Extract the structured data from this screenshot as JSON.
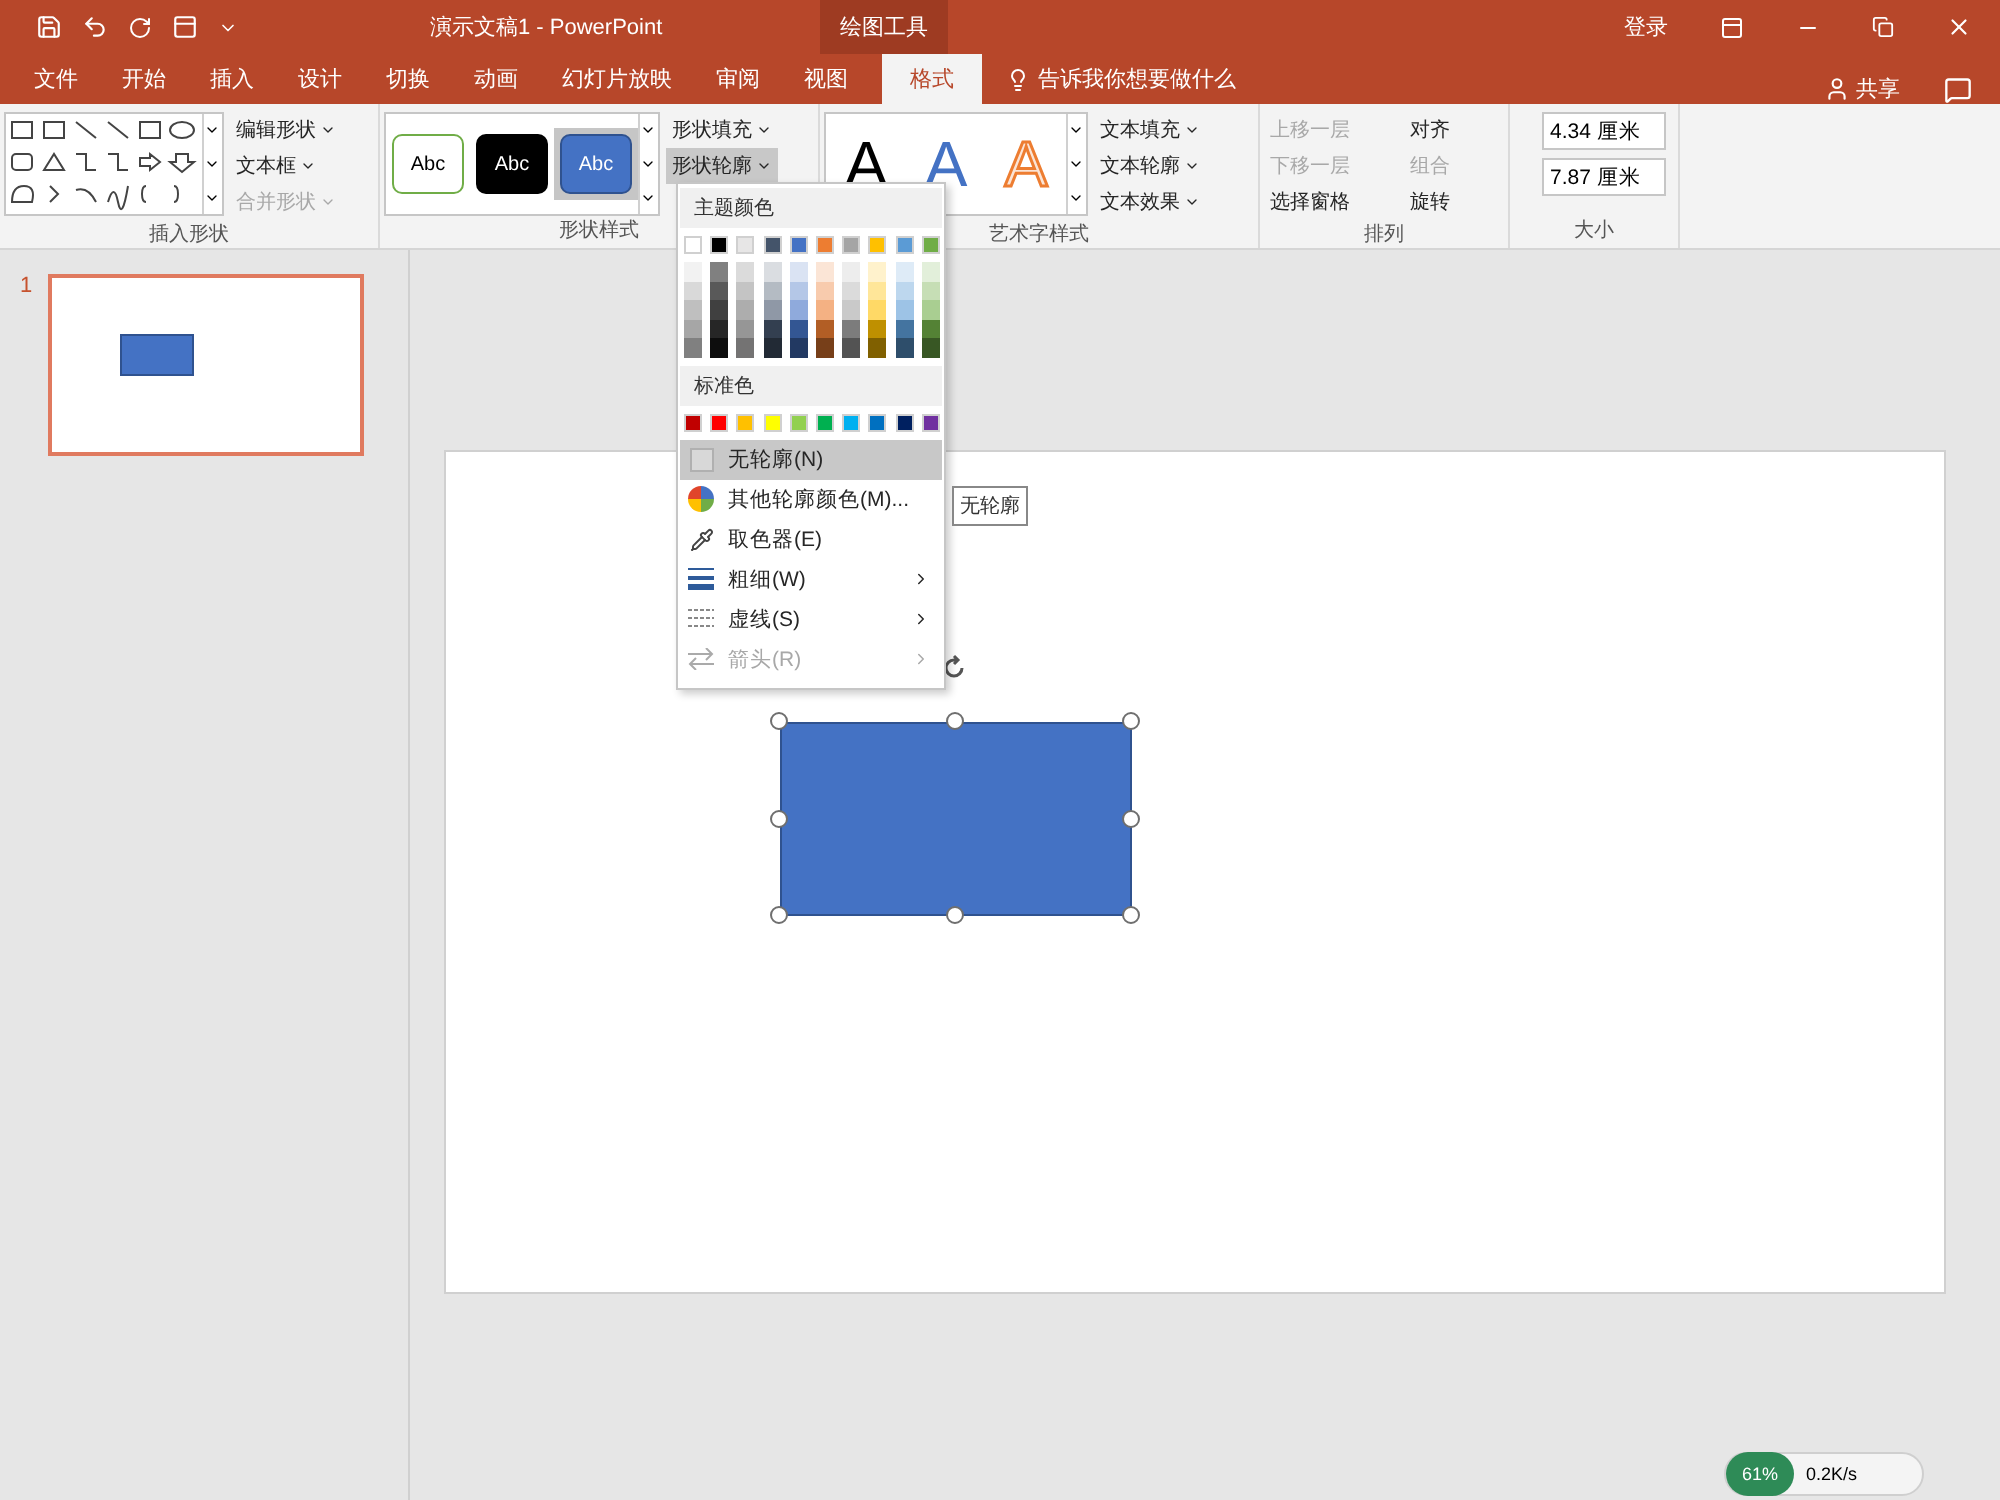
{
  "title_bar": {
    "title": "演示文稿1  -  PowerPoint",
    "context_tab": "绘图工具",
    "sign_in": "登录"
  },
  "tabs": [
    {
      "label": "文件",
      "selected": false
    },
    {
      "label": "开始",
      "selected": false
    },
    {
      "label": "插入",
      "selected": false
    },
    {
      "label": "设计",
      "selected": false
    },
    {
      "label": "切换",
      "selected": false
    },
    {
      "label": "动画",
      "selected": false
    },
    {
      "label": "幻灯片放映",
      "selected": false
    },
    {
      "label": "审阅",
      "selected": false
    },
    {
      "label": "视图",
      "selected": false
    },
    {
      "label": "格式",
      "selected": true
    }
  ],
  "tell_me": {
    "placeholder": "告诉我你想要做什么"
  },
  "share": "共享",
  "ribbon": {
    "insert_shapes": {
      "label": "插入形状",
      "commands": [
        {
          "label": "编辑形状",
          "disabled": false
        },
        {
          "label": "文本框",
          "disabled": false
        },
        {
          "label": "合并形状",
          "disabled": true
        }
      ]
    },
    "shape_styles": {
      "label": "形状样式",
      "samples": [
        {
          "text": "Abc",
          "kind": "outline",
          "selected": false
        },
        {
          "text": "Abc",
          "kind": "dark",
          "selected": false
        },
        {
          "text": "Abc",
          "kind": "blue",
          "selected": true
        }
      ],
      "commands": [
        {
          "label": "形状填充",
          "pressed": false
        },
        {
          "label": "形状轮廓",
          "pressed": true
        }
      ]
    },
    "wordart_styles": {
      "label": "艺术字样式",
      "samples": [
        {
          "text": "A",
          "kind": "black"
        },
        {
          "text": "A",
          "kind": "blue"
        },
        {
          "text": "A",
          "kind": "orange"
        }
      ],
      "commands": [
        {
          "label": "文本填充"
        },
        {
          "label": "文本轮廓"
        },
        {
          "label": "文本效果"
        }
      ]
    },
    "arrange": {
      "label": "排列",
      "commands": [
        {
          "label": "上移一层",
          "disabled": true
        },
        {
          "label": "对齐",
          "disabled": false
        },
        {
          "label": "下移一层",
          "disabled": true
        },
        {
          "label": "组合",
          "disabled": true
        },
        {
          "label": "选择窗格",
          "disabled": false
        },
        {
          "label": "旋转",
          "disabled": false
        }
      ]
    },
    "size": {
      "label": "大小",
      "height": "4.34 厘米",
      "width": "7.87 厘米"
    }
  },
  "slides": [
    {
      "number": "1",
      "selected": true
    }
  ],
  "slide": {
    "shape": {
      "color": "#4472c4",
      "selected": true
    }
  },
  "outline_menu": {
    "theme_heading": "主题颜色",
    "theme_colors": [
      {
        "color": "#ffffff"
      },
      {
        "color": "#000000"
      },
      {
        "color": "#e7e6e6"
      },
      {
        "color": "#44546a"
      },
      {
        "color": "#4472c4"
      },
      {
        "color": "#ed7d31"
      },
      {
        "color": "#a5a5a5"
      },
      {
        "color": "#ffc000"
      },
      {
        "color": "#5b9bd5"
      },
      {
        "color": "#70ad47"
      }
    ],
    "standard_heading": "标准色",
    "standard_colors": [
      {
        "color": "#c00000"
      },
      {
        "color": "#ff0000"
      },
      {
        "color": "#ffc000"
      },
      {
        "color": "#ffff00"
      },
      {
        "color": "#92d050"
      },
      {
        "color": "#00b050"
      },
      {
        "color": "#00b0f0"
      },
      {
        "color": "#0070c0"
      },
      {
        "color": "#002060"
      },
      {
        "color": "#7030a0"
      }
    ],
    "items": [
      {
        "label": "无轮廓(N)",
        "kind": "none",
        "highlighted": true,
        "disabled": false,
        "submenu": false
      },
      {
        "label": "其他轮廓颜色(M)...",
        "kind": "palette",
        "highlighted": false,
        "disabled": false,
        "submenu": false
      },
      {
        "label": "取色器(E)",
        "kind": "eyedropper",
        "highlighted": false,
        "disabled": false,
        "submenu": false
      },
      {
        "label": "粗细(W)",
        "kind": "weight",
        "highlighted": false,
        "disabled": false,
        "submenu": true
      },
      {
        "label": "虚线(S)",
        "kind": "dash",
        "highlighted": false,
        "disabled": false,
        "submenu": true
      },
      {
        "label": "箭头(R)",
        "kind": "arrow",
        "highlighted": false,
        "disabled": true,
        "submenu": true
      }
    ]
  },
  "tooltip": "无轮廓",
  "net_widget": {
    "percent": "61%",
    "speed": "0.2K/s"
  }
}
